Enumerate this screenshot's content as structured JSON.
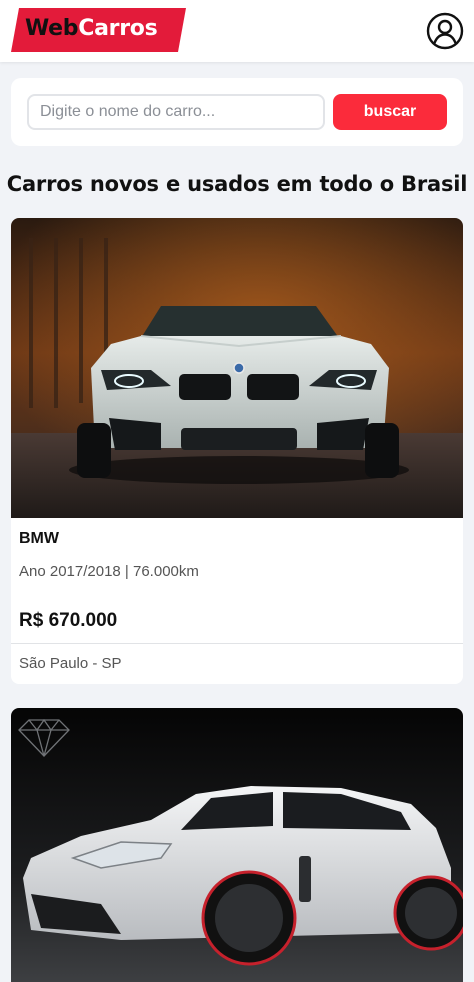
{
  "header": {
    "logo_part1": "Web",
    "logo_part2": "Carros",
    "brand_color": "#e31b3a",
    "profile_icon": "user-circle-icon"
  },
  "search": {
    "placeholder": "Digite o nome do carro...",
    "value": "",
    "button_label": "buscar",
    "button_color": "#fb2b3b"
  },
  "page_title": "Carros novos e usados em todo o Brasil",
  "cars": [
    {
      "name": "BMW",
      "info": "Ano 2017/2018 | 76.000km",
      "price": "R$ 670.000",
      "city": "São Paulo - SP",
      "photo": "white BMW M4 front view photo, autumn trees background"
    },
    {
      "photo": "white Porsche Panamera side view photo, dark background"
    }
  ]
}
